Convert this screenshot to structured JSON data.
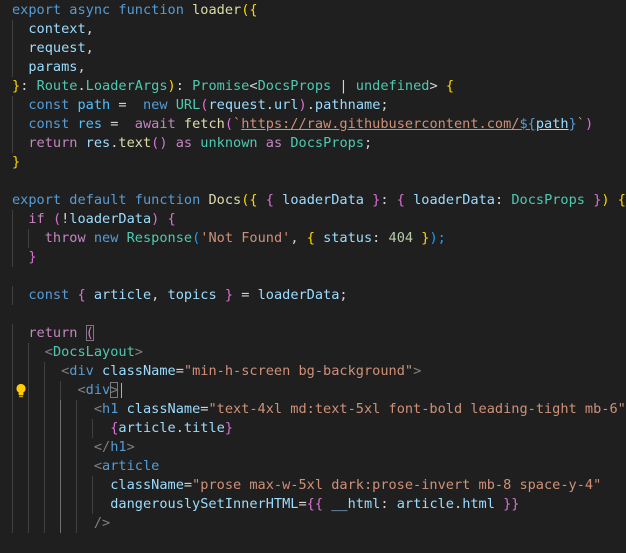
{
  "editor": {
    "theme_colors": {
      "background": "#1f1f1f",
      "keyword": "#569cd6",
      "control": "#c586c0",
      "function": "#dcdcaa",
      "variable": "#9cdcfe",
      "type": "#4ec9b0",
      "string": "#ce9178",
      "number": "#b5cea8"
    },
    "lightbulb_icon": "lightbulb-icon",
    "lines": [
      [
        "export",
        "async",
        "function",
        "loader",
        "({"
      ],
      [
        "context",
        ","
      ],
      [
        "request",
        ","
      ],
      [
        "params",
        ","
      ],
      [
        "}",
        ":",
        "Route",
        ".",
        "LoaderArgs",
        ")",
        ":",
        "Promise",
        "<",
        "DocsProps",
        "|",
        "undefined",
        ">",
        "{"
      ],
      [
        "const",
        "path",
        "=",
        "new",
        "URL",
        "(",
        "request",
        ".",
        "url",
        ")",
        ".",
        "pathname",
        ";"
      ],
      [
        "const",
        "res",
        "=",
        "await",
        "fetch",
        "(",
        "`",
        "https://raw.githubusercontent.com/",
        "${",
        "path",
        "}",
        "`",
        ")"
      ],
      [
        "return",
        "res",
        ".",
        "text",
        "()",
        "as",
        "unknown",
        "as",
        "DocsProps",
        ";"
      ],
      [
        "}"
      ],
      [],
      [
        "export",
        "default",
        "function",
        "Docs",
        "({",
        "{",
        "loaderData",
        "}",
        ":",
        "{",
        "loaderData",
        ":",
        "DocsProps",
        "}",
        ")",
        "{"
      ],
      [
        "if",
        "(",
        "!",
        "loaderData",
        ")",
        "{"
      ],
      [
        "throw",
        "new",
        "Response",
        "(",
        "'Not Found'",
        ",",
        "{",
        "status",
        ":",
        "404",
        "}",
        ");"
      ],
      [
        "}"
      ],
      [],
      [
        "const",
        "{",
        "article",
        ",",
        "topics",
        "}",
        "=",
        "loaderData",
        ";"
      ],
      [],
      [
        "return",
        "("
      ],
      [
        "<",
        "DocsLayout",
        ">"
      ],
      [
        "<",
        "div",
        "className",
        "=",
        "\"min-h-screen bg-background\"",
        ">"
      ],
      [
        "<",
        "div",
        ">"
      ],
      [
        "<",
        "h1",
        "className",
        "=",
        "\"text-4xl md:text-5xl font-bold leading-tight mb-6\"",
        ">"
      ],
      [
        "{",
        "article",
        ".",
        "title",
        "}"
      ],
      [
        "</",
        "h1",
        ">"
      ],
      [
        "<",
        "article"
      ],
      [
        "className",
        "=",
        "\"prose max-w-5xl dark:prose-invert mb-8 space-y-4\""
      ],
      [
        "dangerouslySetInnerHTML",
        "=",
        "{{",
        "__html",
        ":",
        "article",
        ".",
        "html",
        "}}"
      ],
      [
        "/>"
      ]
    ]
  }
}
